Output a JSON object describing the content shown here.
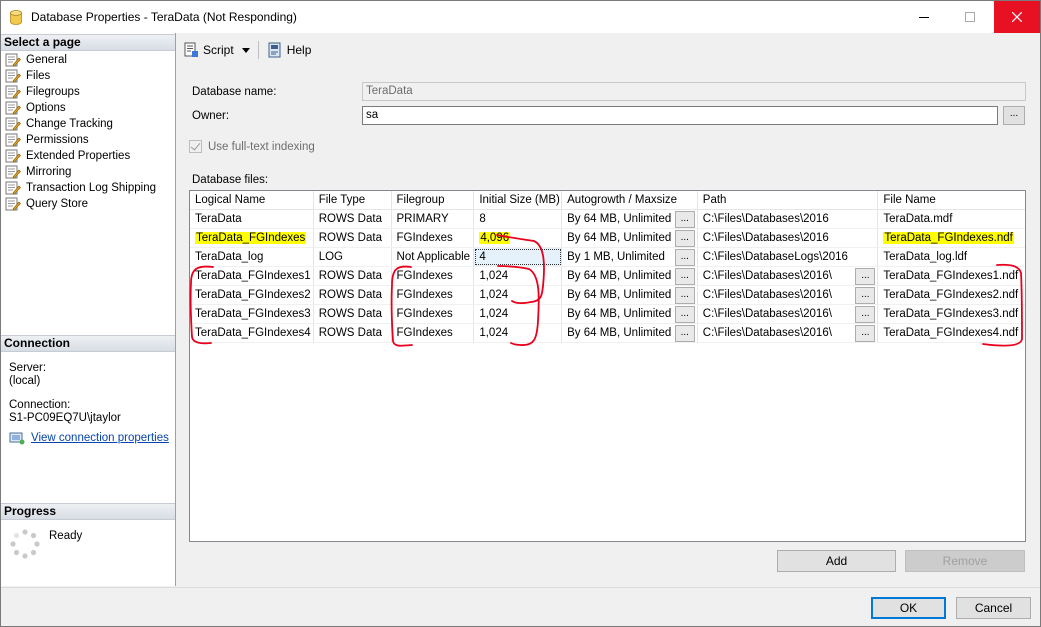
{
  "window": {
    "title": "Database Properties - TeraData (Not Responding)"
  },
  "left_panel": {
    "select_page_header": "Select a page",
    "pages": [
      {
        "label": "General",
        "icon": "page-wrench-icon"
      },
      {
        "label": "Files",
        "icon": "page-wrench-icon"
      },
      {
        "label": "Filegroups",
        "icon": "page-wrench-icon"
      },
      {
        "label": "Options",
        "icon": "page-wrench-icon"
      },
      {
        "label": "Change Tracking",
        "icon": "page-wrench-icon"
      },
      {
        "label": "Permissions",
        "icon": "page-wrench-icon"
      },
      {
        "label": "Extended Properties",
        "icon": "page-wrench-icon"
      },
      {
        "label": "Mirroring",
        "icon": "page-wrench-icon"
      },
      {
        "label": "Transaction Log Shipping",
        "icon": "page-wrench-icon"
      },
      {
        "label": "Query Store",
        "icon": "page-wrench-icon"
      }
    ],
    "connection_header": "Connection",
    "server_label": "Server:",
    "server_value": "(local)",
    "connection_label": "Connection:",
    "connection_value": "S1-PC09EQ7U\\jtaylor",
    "view_connection_link": "View connection properties",
    "progress_header": "Progress",
    "progress_status": "Ready"
  },
  "toolbar": {
    "script_label": "Script",
    "help_label": "Help"
  },
  "form": {
    "db_name_label": "Database name:",
    "db_name_value": "TeraData",
    "owner_label": "Owner:",
    "owner_value": "sa",
    "owner_browse": "...",
    "fulltext_label": "Use full-text indexing",
    "db_files_label": "Database files:"
  },
  "grid": {
    "columns": [
      "Logical Name",
      "File Type",
      "Filegroup",
      "Initial Size (MB)",
      "Autogrowth / Maxsize",
      "Path",
      "File Name"
    ],
    "rows": [
      {
        "name": "TeraData",
        "type": "ROWS Data",
        "filegroup": "PRIMARY",
        "size": "8",
        "autogrowth": "By 64 MB, Unlimited",
        "path": "C:\\Files\\Databases\\2016",
        "file": "TeraData.mdf",
        "path_btn": false,
        "hl_name": false,
        "hl_size": false,
        "hl_file": false,
        "focus_size": false
      },
      {
        "name": "TeraData_FGIndexes",
        "type": "ROWS Data",
        "filegroup": "FGIndexes",
        "size": "4,096",
        "autogrowth": "By 64 MB, Unlimited",
        "path": "C:\\Files\\Databases\\2016",
        "file": "TeraData_FGIndexes.ndf",
        "path_btn": false,
        "hl_name": true,
        "hl_size": true,
        "hl_file": true,
        "focus_size": false
      },
      {
        "name": "TeraData_log",
        "type": "LOG",
        "filegroup": "Not Applicable",
        "size": "4",
        "autogrowth": "By 1 MB, Unlimited",
        "path": "C:\\Files\\DatabaseLogs\\2016",
        "file": "TeraData_log.ldf",
        "path_btn": false,
        "hl_name": false,
        "hl_size": false,
        "hl_file": false,
        "focus_size": true
      },
      {
        "name": "TeraData_FGIndexes1",
        "type": "ROWS Data",
        "filegroup": "FGIndexes",
        "size": "1,024",
        "autogrowth": "By 64 MB, Unlimited",
        "path": "C:\\Files\\Databases\\2016\\",
        "file": "TeraData_FGIndexes1.ndf",
        "path_btn": true,
        "hl_name": false,
        "hl_size": false,
        "hl_file": false,
        "focus_size": false
      },
      {
        "name": "TeraData_FGIndexes2",
        "type": "ROWS Data",
        "filegroup": "FGIndexes",
        "size": "1,024",
        "autogrowth": "By 64 MB, Unlimited",
        "path": "C:\\Files\\Databases\\2016\\",
        "file": "TeraData_FGIndexes2.ndf",
        "path_btn": true,
        "hl_name": false,
        "hl_size": false,
        "hl_file": false,
        "focus_size": false
      },
      {
        "name": "TeraData_FGIndexes3",
        "type": "ROWS Data",
        "filegroup": "FGIndexes",
        "size": "1,024",
        "autogrowth": "By 64 MB, Unlimited",
        "path": "C:\\Files\\Databases\\2016\\",
        "file": "TeraData_FGIndexes3.ndf",
        "path_btn": true,
        "hl_name": false,
        "hl_size": false,
        "hl_file": false,
        "focus_size": false
      },
      {
        "name": "TeraData_FGIndexes4",
        "type": "ROWS Data",
        "filegroup": "FGIndexes",
        "size": "1,024",
        "autogrowth": "By 64 MB, Unlimited",
        "path": "C:\\Files\\Databases\\2016\\",
        "file": "TeraData_FGIndexes4.ndf",
        "path_btn": true,
        "hl_name": false,
        "hl_size": false,
        "hl_file": false,
        "focus_size": false
      }
    ],
    "cell_button_label": "..."
  },
  "buttons": {
    "add": "Add",
    "remove": "Remove",
    "ok": "OK",
    "cancel": "Cancel"
  },
  "colors": {
    "highlight": "#ffff00",
    "annotation": "#e8001c",
    "close_button": "#e81123",
    "link": "#0645ad"
  }
}
